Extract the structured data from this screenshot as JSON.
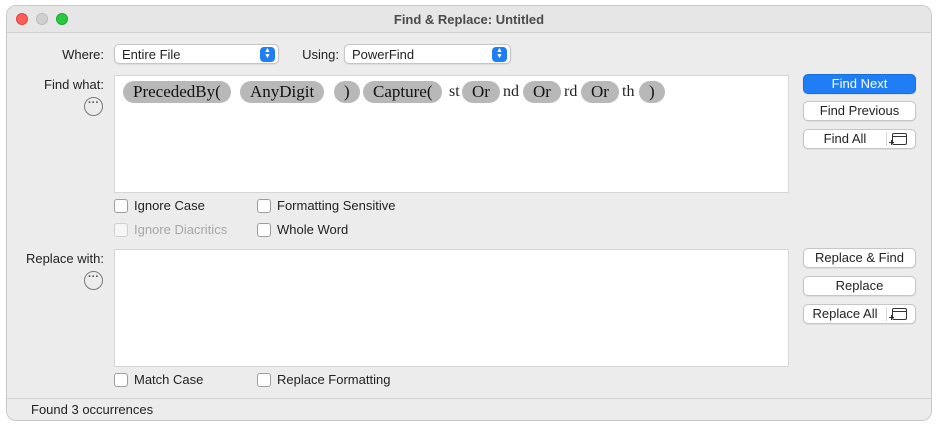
{
  "window": {
    "title": "Find & Replace: Untitled"
  },
  "where": {
    "label": "Where:",
    "value": "Entire File"
  },
  "using": {
    "label": "Using:",
    "value": "PowerFind"
  },
  "find": {
    "label": "Find what:",
    "tokens": [
      "PrecededBy(",
      "AnyDigit",
      ")",
      "Capture(",
      "st",
      "Or",
      "nd",
      "Or",
      "rd",
      "Or",
      "th",
      ")"
    ]
  },
  "find_options": {
    "ignore_case": "Ignore Case",
    "ignore_diacritics": "Ignore Diacritics",
    "formatting_sensitive": "Formatting Sensitive",
    "whole_word": "Whole Word"
  },
  "replace": {
    "label": "Replace with:",
    "value": ""
  },
  "replace_options": {
    "match_case": "Match Case",
    "replace_formatting": "Replace Formatting"
  },
  "buttons": {
    "find_next": "Find Next",
    "find_previous": "Find Previous",
    "find_all": "Find All",
    "replace_and_find": "Replace & Find",
    "replace": "Replace",
    "replace_all": "Replace All"
  },
  "status": "Found 3 occurrences",
  "colors": {
    "accent": "#1f7ef5",
    "token": "#b8b8b8"
  }
}
